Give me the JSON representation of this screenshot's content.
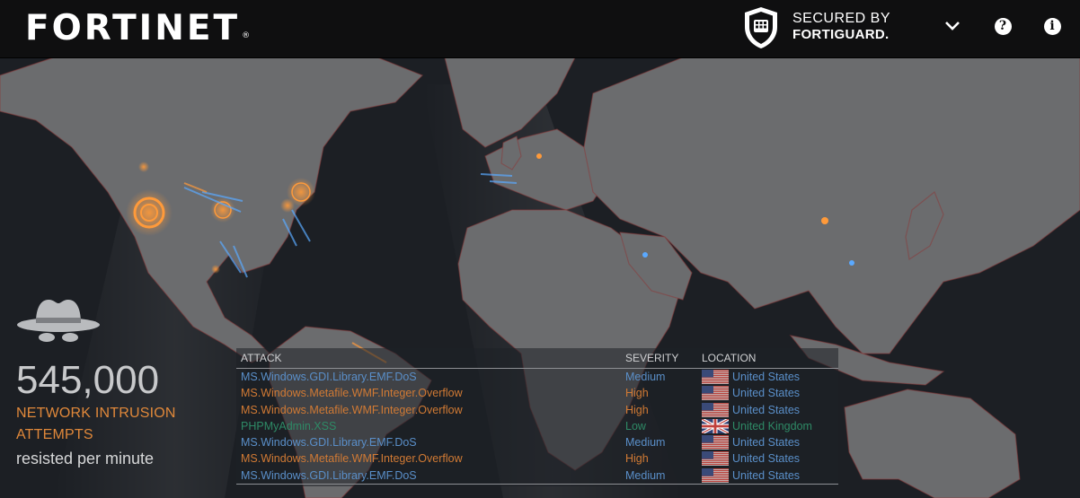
{
  "header": {
    "logo_text": "FORTINET",
    "logo_reg": "®",
    "secured_line1": "SECURED BY",
    "secured_line2": "FORTIGUARD.",
    "icons": [
      "fortiguard-shield-icon",
      "chevron-down-icon",
      "help-icon",
      "info-icon"
    ],
    "help_glyph": "?",
    "info_glyph": "i"
  },
  "stats": {
    "icon": "spy-hat-icon",
    "count": "545,000",
    "label_line1": "NETWORK INTRUSION",
    "label_line2": "ATTEMPTS",
    "subtitle": "resisted per minute"
  },
  "table": {
    "columns": {
      "attack": "ATTACK",
      "severity": "SEVERITY",
      "location": "LOCATION"
    },
    "rows": [
      {
        "attack": "MS.Windows.GDI.Library.EMF.DoS",
        "severity": "Medium",
        "location": "United States",
        "flag": "us"
      },
      {
        "attack": "MS.Windows.Metafile.WMF.Integer.Overflow",
        "severity": "High",
        "location": "United States",
        "flag": "us"
      },
      {
        "attack": "MS.Windows.Metafile.WMF.Integer.Overflow",
        "severity": "High",
        "location": "United States",
        "flag": "us"
      },
      {
        "attack": "PHPMyAdmin.XSS",
        "severity": "Low",
        "location": "United Kingdom",
        "flag": "uk"
      },
      {
        "attack": "MS.Windows.GDI.Library.EMF.DoS",
        "severity": "Medium",
        "location": "United States",
        "flag": "us"
      },
      {
        "attack": "MS.Windows.Metafile.WMF.Integer.Overflow",
        "severity": "High",
        "location": "United States",
        "flag": "us"
      },
      {
        "attack": "MS.Windows.GDI.Library.EMF.DoS",
        "severity": "Medium",
        "location": "United States",
        "flag": "us"
      }
    ]
  },
  "colors": {
    "header_bg": "#0f0f10",
    "ocean": "#1c1f24",
    "land": "#6b6c6e",
    "accent_orange": "#e0883a",
    "severity_medium": "#5a8fc9",
    "severity_high": "#d17a34",
    "severity_low": "#2e8a66"
  }
}
